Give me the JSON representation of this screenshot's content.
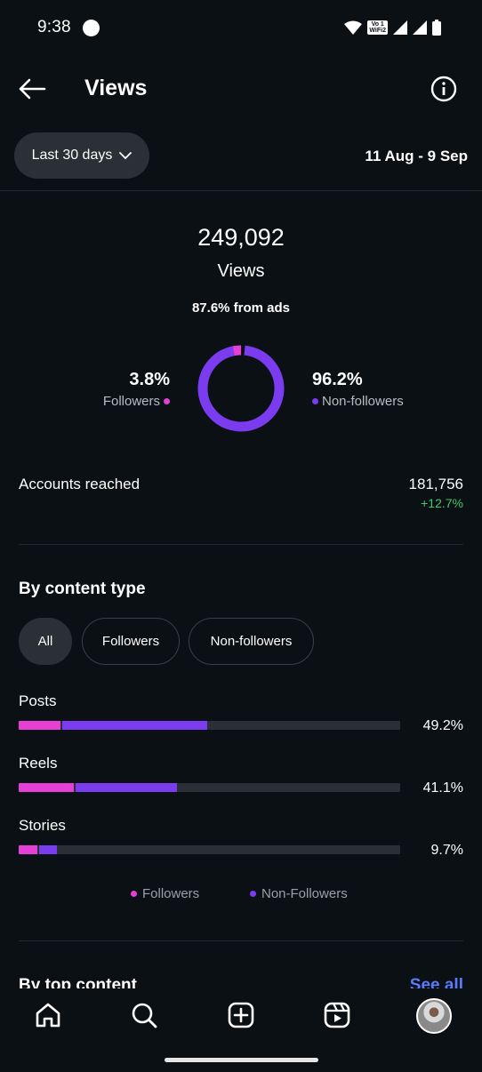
{
  "status_bar": {
    "time": "9:38",
    "network_label_top": "Vo 1",
    "network_label_bottom": "WiFi2"
  },
  "header": {
    "title": "Views"
  },
  "date_filter": {
    "range_label": "Last 30 days",
    "date_range": "11 Aug - 9 Sep"
  },
  "summary": {
    "total_views": "249,092",
    "views_label": "Views",
    "ads_note": "87.6% from ads",
    "followers_pct": "3.8%",
    "followers_label": "Followers",
    "followers_share": 0.038,
    "nonfollowers_pct": "96.2%",
    "nonfollowers_label": "Non-followers",
    "nonfollowers_share": 0.962
  },
  "accounts_reached": {
    "label": "Accounts reached",
    "value": "181,756",
    "change": "+12.7%"
  },
  "content_type": {
    "title": "By content type",
    "chips": [
      {
        "label": "All",
        "active": true
      },
      {
        "label": "Followers",
        "active": false
      },
      {
        "label": "Non-followers",
        "active": false
      }
    ],
    "rows": [
      {
        "label": "Posts",
        "pct_text": "49.2%",
        "followers_fraction": 0.11,
        "nonfollowers_fraction": 0.38
      },
      {
        "label": "Reels",
        "pct_text": "41.1%",
        "followers_fraction": 0.145,
        "nonfollowers_fraction": 0.265
      },
      {
        "label": "Stories",
        "pct_text": "9.7%",
        "followers_fraction": 0.05,
        "nonfollowers_fraction": 0.047
      }
    ],
    "legend": {
      "followers": "Followers",
      "nonfollowers": "Non-Followers"
    }
  },
  "top_content": {
    "title": "By top content",
    "see_all": "See all"
  },
  "colors": {
    "followers": "#e63fd6",
    "nonfollowers": "#7b3cf0",
    "positive": "#3fc96a",
    "link": "#5b7cfa",
    "background": "#0b1014"
  },
  "nav": {
    "icons": [
      "home-icon",
      "search-icon",
      "create-icon",
      "reels-icon",
      "profile-avatar"
    ]
  }
}
